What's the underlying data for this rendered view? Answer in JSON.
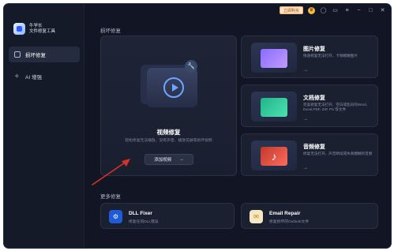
{
  "app": {
    "brand_line1": "牛学长",
    "brand_line2": "文件修复工具"
  },
  "topbar": {
    "buy_label": "立即购买"
  },
  "sidebar": {
    "items": [
      {
        "label": "损坏修复",
        "icon": "repair-icon",
        "active": true
      },
      {
        "label": "AI 增强",
        "icon": "ai-sparkle-icon",
        "active": false
      }
    ]
  },
  "main": {
    "section_title": "损坏修复",
    "video": {
      "title": "视频修复",
      "desc": "轻松修复无法播放、没有声音、播放花屏等损坏视频",
      "button_label": "添加视频",
      "button_arrow": "→"
    },
    "photo": {
      "title": "图片修复",
      "desc": "快速修复无法打开、卡顿模糊图片",
      "arrow": "→"
    },
    "document": {
      "title": "文档修复",
      "desc": "完美修复无法打开、空白或乱码的Word, Excel,PDF, ZIP, PS 等文件",
      "arrow": "→"
    },
    "audio": {
      "title": "音频修复",
      "desc": "修复无法打开、声音断续或失真模糊的音频",
      "arrow": "→"
    },
    "more_title": "更多修复",
    "dll": {
      "title": "DLL Fixer",
      "desc": "修复任何DLL错误"
    },
    "email": {
      "title": "Email Repair",
      "desc": "修复损坏的Outlook文件"
    }
  },
  "colors": {
    "background": "#121624",
    "card": "#1b2031",
    "accent_blue": "#6da6ff",
    "arrow_red": "#d6302a"
  }
}
